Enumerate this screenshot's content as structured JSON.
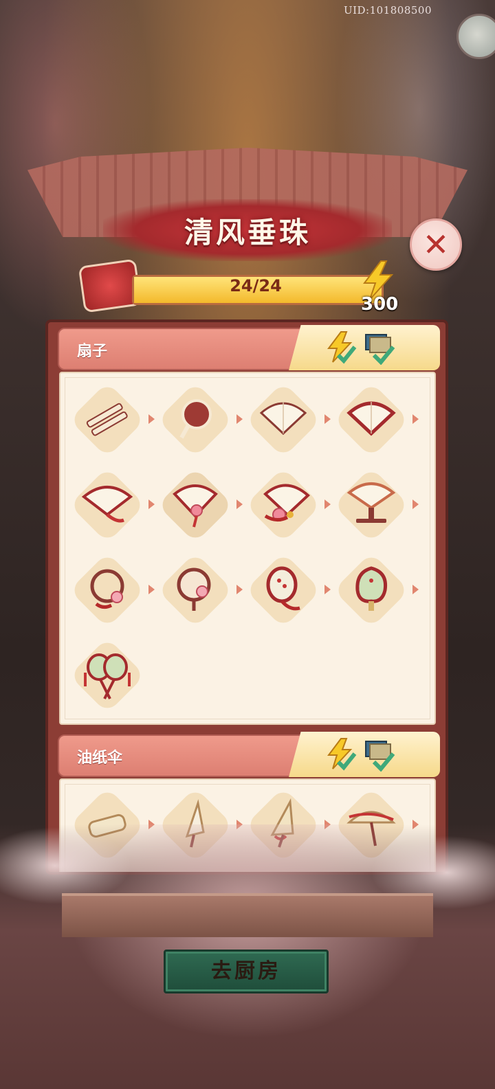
{
  "header": {
    "uid": "UID:101808500"
  },
  "title": "清风垂珠",
  "progress": {
    "text": "24/24",
    "fraction": 1.0
  },
  "energy": {
    "count": "300"
  },
  "sections": [
    {
      "label": "扇子",
      "items": [
        "bamboo-slats",
        "round-fan-frame",
        "folding-fan-plain",
        "folding-fan-red-edge",
        "folding-fan-tassel",
        "folding-fan-flower",
        "folding-fan-flower-knot",
        "folding-fan-stand",
        "round-fan-ring",
        "round-fan-blossom",
        "round-fan-painted",
        "round-fan-green-flower",
        "double-round-fan"
      ]
    },
    {
      "label": "油纸伞",
      "items": [
        "paper-roll",
        "closed-umbrella-plain",
        "closed-umbrella-ribbon",
        "open-umbrella-ribbon"
      ]
    }
  ],
  "buttons": {
    "go_kitchen": "去厨房"
  },
  "colors": {
    "accent_red": "#a42a2d",
    "cell_bg": "#f3dfbd",
    "button_green": "#2f6a52"
  }
}
